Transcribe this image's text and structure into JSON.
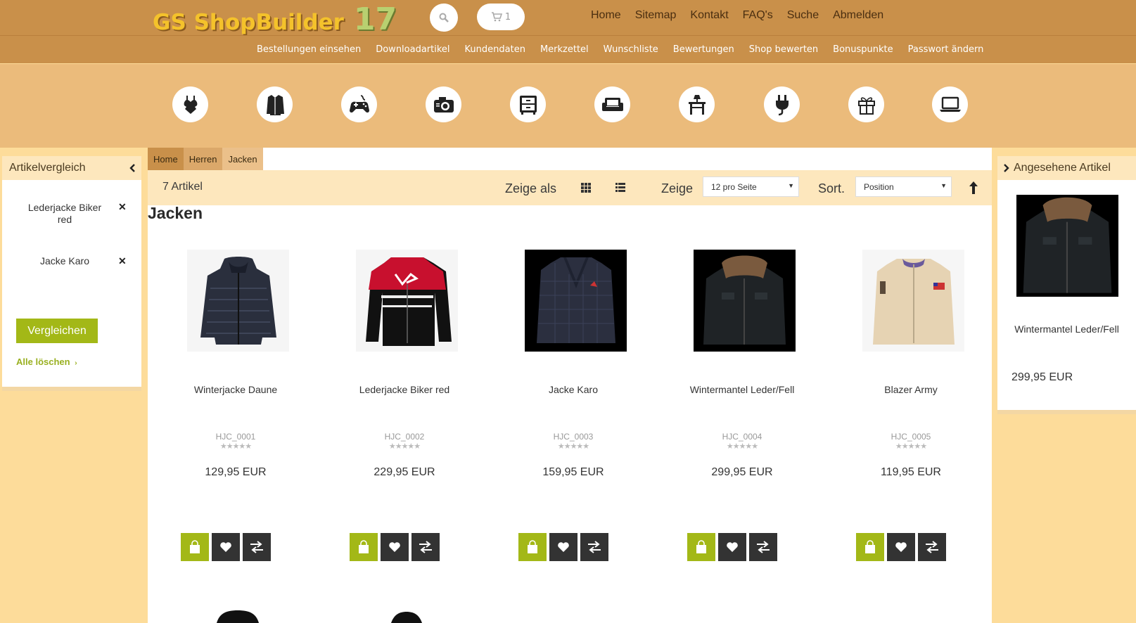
{
  "header": {
    "logo_text": "GS ShopBuilder",
    "logo_number": "17",
    "cart_count": "1",
    "nav": [
      "Home",
      "Sitemap",
      "Kontakt",
      "FAQ's",
      "Suche",
      "Abmelden"
    ],
    "subnav": [
      "Bestellungen einsehen",
      "Downloadartikel",
      "Kundendaten",
      "Merkzettel",
      "Wunschliste",
      "Bewertungen",
      "Shop bewerten",
      "Bonuspunkte",
      "Passwort ändern"
    ]
  },
  "categories": [
    "lingerie-icon",
    "coat-icon",
    "gamepad-icon",
    "camera-icon",
    "dresser-icon",
    "sofa-icon",
    "table-lamp-icon",
    "plug-icon",
    "gift-icon",
    "laptop-icon"
  ],
  "compare": {
    "title": "Artikelvergleich",
    "items": [
      "Lederjacke Biker red",
      "Jacke Karo"
    ],
    "compare_button": "Vergleichen",
    "clear_all": "Alle löschen"
  },
  "breadcrumb": [
    "Home",
    "Herren",
    "Jacken"
  ],
  "toolbar": {
    "count": "7 Artikel",
    "view_label": "Zeige als",
    "show_label": "Zeige",
    "per_page": "12 pro Seite",
    "sort_label": "Sort.",
    "sort_value": "Position"
  },
  "page_title": "Jacken",
  "products": [
    {
      "name": "Winterjacke Daune",
      "sku": "HJC_0001",
      "price": "129,95 EUR"
    },
    {
      "name": "Lederjacke Biker red",
      "sku": "HJC_0002",
      "price": "229,95 EUR"
    },
    {
      "name": "Jacke Karo",
      "sku": "HJC_0003",
      "price": "159,95 EUR"
    },
    {
      "name": "Wintermantel Leder/Fell",
      "sku": "HJC_0004",
      "price": "299,95 EUR"
    },
    {
      "name": "Blazer Army",
      "sku": "HJC_0005",
      "price": "119,95 EUR"
    }
  ],
  "recently_viewed": {
    "title": "Angesehene Artikel",
    "name": "Wintermantel Leder/Fell",
    "price": "299,95 EUR"
  },
  "colors": {
    "accent_green": "#a3b817",
    "header_brown": "#c9904a",
    "band": "#ebbb7b",
    "background": "#fddc9a"
  }
}
